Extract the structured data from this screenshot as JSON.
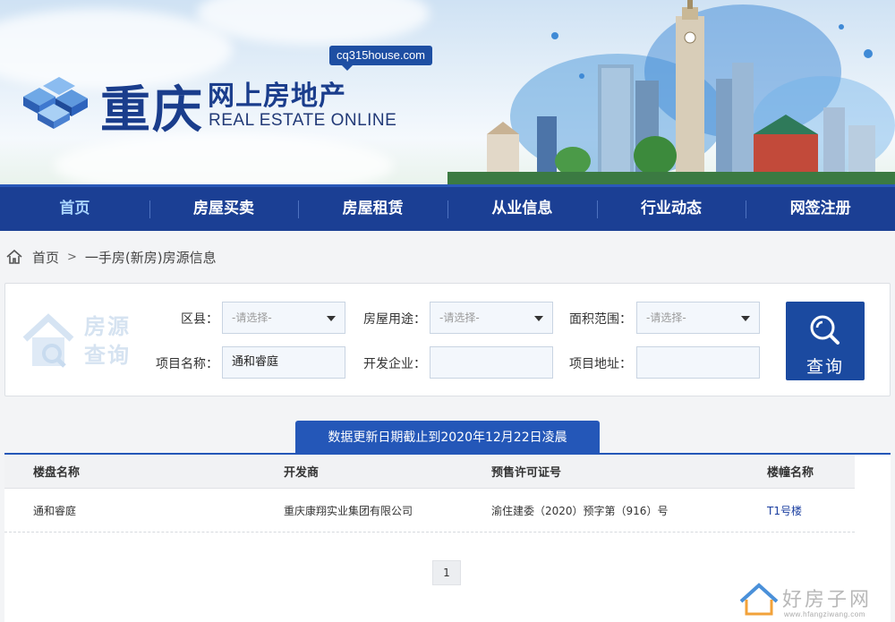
{
  "header": {
    "domain_badge": "cq315house.com",
    "logo_cn_city": "重庆",
    "logo_cn_title": "网上房地产",
    "logo_en_title": "REAL ESTATE ONLINE"
  },
  "nav": {
    "items": [
      {
        "label": "首页",
        "active": true
      },
      {
        "label": "房屋买卖"
      },
      {
        "label": "房屋租赁"
      },
      {
        "label": "从业信息"
      },
      {
        "label": "行业动态"
      },
      {
        "label": "网签注册"
      }
    ]
  },
  "breadcrumb": {
    "home": "首页",
    "separator": ">",
    "current": "一手房(新房)房源信息"
  },
  "search": {
    "watermark_line1": "房源",
    "watermark_line2": "查询",
    "district_label": "区县：",
    "district_value": "-请选择-",
    "usage_label": "房屋用途：",
    "usage_value": "-请选择-",
    "area_label": "面积范围：",
    "area_value": "-请选择-",
    "project_label": "项目名称：",
    "project_value": "通和睿庭",
    "developer_label": "开发企业：",
    "developer_value": "",
    "address_label": "项目地址：",
    "address_value": "",
    "button_label": "查询"
  },
  "notice": {
    "text": "数据更新日期截止到2020年12月22日凌晨"
  },
  "table": {
    "headers": [
      "楼盘名称",
      "开发商",
      "预售许可证号",
      "楼幢名称"
    ],
    "rows": [
      [
        "通和睿庭",
        "重庆康翔实业集团有限公司",
        "渝住建委（2020）预字第（916）号",
        "T1号楼"
      ]
    ]
  },
  "pagination": {
    "current_page": "1"
  },
  "site_watermark": {
    "text": "好房子网",
    "url": "www.hfangziwang.com"
  },
  "colors": {
    "nav_bg": "#1b3f94",
    "brand_blue": "#1a3d8c",
    "button_blue": "#1b4aa0",
    "notice_blue": "#2457b8",
    "link_blue": "#1b3fa0"
  }
}
